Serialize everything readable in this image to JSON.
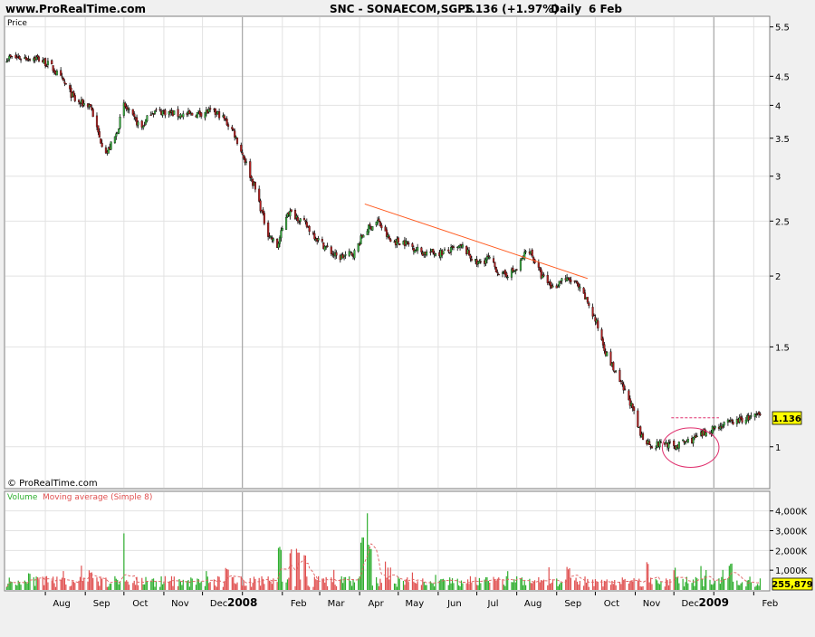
{
  "header": {
    "site": "www.ProRealTime.com",
    "symbol": "SNC - SONAECOM,SGPS",
    "price_change": "1.136 (+1.97%)",
    "period": "Daily",
    "date": "6 Feb"
  },
  "watermark": "© ProRealTime.com",
  "chart_data": [
    {
      "type": "line",
      "subtype": "candlestick",
      "title": "",
      "ylabel": "Price",
      "yscale": "log",
      "ylim": [
        0.85,
        5.7
      ],
      "y_ticks": [
        "1",
        "1.5",
        "2",
        "2.5",
        "3",
        "3.5",
        "4",
        "4.5",
        "5.5"
      ],
      "x_ticks": [
        "Aug",
        "Sep",
        "Oct",
        "Nov",
        "Dec",
        "2008",
        "Feb",
        "Mar",
        "Apr",
        "May",
        "Jun",
        "Jul",
        "Aug",
        "Sep",
        "Oct",
        "Nov",
        "Dec",
        "2009",
        "Feb"
      ],
      "x_tick_months": [
        "2007-08",
        "2007-09",
        "2007-10",
        "2007-11",
        "2007-12",
        "2008-01",
        "2008-02",
        "2008-03",
        "2008-04",
        "2008-05",
        "2008-06",
        "2008-07",
        "2008-08",
        "2008-09",
        "2008-10",
        "2008-11",
        "2008-12",
        "2009-01",
        "2009-02"
      ],
      "year_separators": [
        "2008",
        "2009"
      ],
      "last_value": "1.136",
      "x": [
        "2007-07-15",
        "2007-07-25",
        "2007-08-05",
        "2007-08-15",
        "2007-08-25",
        "2007-09-05",
        "2007-09-12",
        "2007-09-18",
        "2007-09-25",
        "2007-10-01",
        "2007-10-08",
        "2007-10-15",
        "2007-10-22",
        "2007-11-01",
        "2007-11-12",
        "2007-11-22",
        "2007-12-05",
        "2007-12-15",
        "2007-12-25",
        "2008-01-03",
        "2008-01-12",
        "2008-01-20",
        "2008-01-28",
        "2008-02-05",
        "2008-02-12",
        "2008-02-20",
        "2008-03-01",
        "2008-03-15",
        "2008-03-28",
        "2008-04-05",
        "2008-04-15",
        "2008-04-25",
        "2008-05-05",
        "2008-05-20",
        "2008-06-05",
        "2008-06-20",
        "2008-07-01",
        "2008-07-10",
        "2008-07-20",
        "2008-08-01",
        "2008-08-10",
        "2008-08-20",
        "2008-08-30",
        "2008-09-05",
        "2008-09-15",
        "2008-09-25",
        "2008-10-02",
        "2008-10-10",
        "2008-10-20",
        "2008-10-28",
        "2008-11-05",
        "2008-11-15",
        "2008-11-22",
        "2008-12-01",
        "2008-12-10",
        "2008-12-20",
        "2009-01-01",
        "2009-01-12",
        "2009-01-25",
        "2009-02-06"
      ],
      "series": [
        {
          "values": [
            4.85,
            4.85,
            4.7,
            4.4,
            4.05,
            4.0,
            3.5,
            3.3,
            3.55,
            4.0,
            3.8,
            3.65,
            3.9,
            3.9,
            3.85,
            3.85,
            3.9,
            3.85,
            3.6,
            3.2,
            2.8,
            2.4,
            2.25,
            2.6,
            2.55,
            2.45,
            2.3,
            2.15,
            2.2,
            2.4,
            2.5,
            2.3,
            2.3,
            2.2,
            2.2,
            2.25,
            2.1,
            2.15,
            2.0,
            2.05,
            2.25,
            2.0,
            1.9,
            1.98,
            1.95,
            1.8,
            1.65,
            1.45,
            1.3,
            1.2,
            1.05,
            1.0,
            1.02,
            1.0,
            1.02,
            1.04,
            1.08,
            1.1,
            1.12,
            1.136
          ]
        }
      ],
      "trendline": {
        "x": [
          "2008-04-05",
          "2008-09-25"
        ],
        "y": [
          2.68,
          1.98
        ]
      },
      "resistance_line": {
        "x": [
          "2008-11-29",
          "2009-01-05"
        ],
        "y": [
          1.125,
          1.125
        ]
      },
      "highlight_ellipse": {
        "x": [
          "2008-11-22",
          "2009-01-05"
        ],
        "y": [
          0.92,
          1.08
        ]
      }
    },
    {
      "type": "bar",
      "title": "Volume Moving average (Simple 8)",
      "legend": [
        {
          "name": "Volume",
          "color": "#2fae2f"
        },
        {
          "name": "Moving average (Simple 8)",
          "color": "#e05050"
        }
      ],
      "y_ticks": [
        "1,000K",
        "2,000K",
        "3,000K",
        "4,000K"
      ],
      "ylim": [
        0,
        4900
      ],
      "y_unit": "K",
      "last_value": "255,879",
      "spikes": {
        "x": [
          "2007-07-20",
          "2007-09-05",
          "2007-09-30",
          "2007-12-20",
          "2008-01-30",
          "2008-02-08",
          "2008-02-13",
          "2008-02-18",
          "2008-04-03",
          "2008-04-06",
          "2008-04-09",
          "2008-04-20",
          "2008-09-10",
          "2008-11-10",
          "2008-12-01",
          "2009-01-14"
        ],
        "values": [
          900,
          1000,
          3100,
          1200,
          2200,
          2100,
          2200,
          1800,
          2800,
          4100,
          2300,
          1500,
          1200,
          1500,
          1100,
          1400
        ]
      }
    }
  ],
  "colors": {
    "background": "#f0f0f0",
    "plot": "#ffffff",
    "up_candle": "#3cb043",
    "down_candle": "#b02020",
    "trendline": "#ff5a1f",
    "ellipse": "#e0306e",
    "volume_bar": "#2fae2f",
    "volume_down": "#e05050",
    "moving_average": "#e06060",
    "last_label_bg": "#ffff00"
  }
}
